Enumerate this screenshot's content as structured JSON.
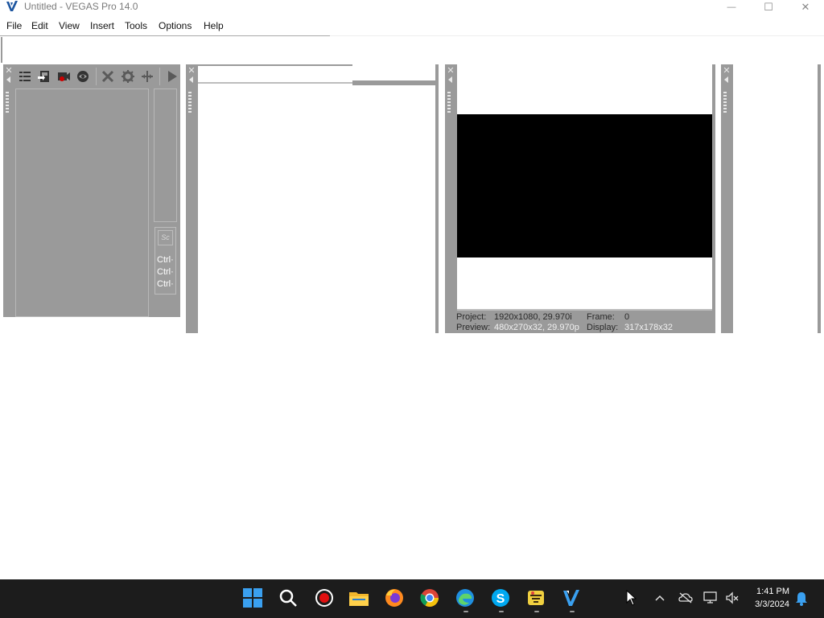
{
  "window": {
    "title": "Untitled - VEGAS Pro 14.0",
    "controls": {
      "minimize": "—",
      "maximize": "☐",
      "close": "✕"
    }
  },
  "menu": {
    "items": [
      "File",
      "Edit",
      "View",
      "Insert",
      "Tools",
      "Options",
      "Help"
    ]
  },
  "explorer_panel": {
    "toolbar_icons": [
      "thumbnail-view-icon",
      "import-media-icon",
      "capture-icon",
      "get-media-icon",
      "remove-icon",
      "properties-icon",
      "split-icon",
      "play-icon"
    ],
    "shortcut_label": "Sc",
    "ctrl_lines": [
      "Ctrl·",
      "Ctrl·",
      "Ctrl·"
    ]
  },
  "preview": {
    "project_label": "Project:",
    "project_value": "1920x1080, 29.970i",
    "frame_label": "Frame:",
    "frame_value": "0",
    "preview_label": "Preview:",
    "preview_value": "480x270x32, 29.970p",
    "display_label": "Display:",
    "display_value": "317x178x32"
  },
  "taskbar": {
    "apps": [
      "start-icon",
      "search-icon",
      "record-icon",
      "file-explorer-icon",
      "firefox-icon",
      "chrome-icon",
      "edge-icon",
      "skype-icon",
      "game-icon",
      "vegas-icon"
    ],
    "tray": {
      "time": "1:41 PM",
      "date": "3/3/2024"
    }
  }
}
